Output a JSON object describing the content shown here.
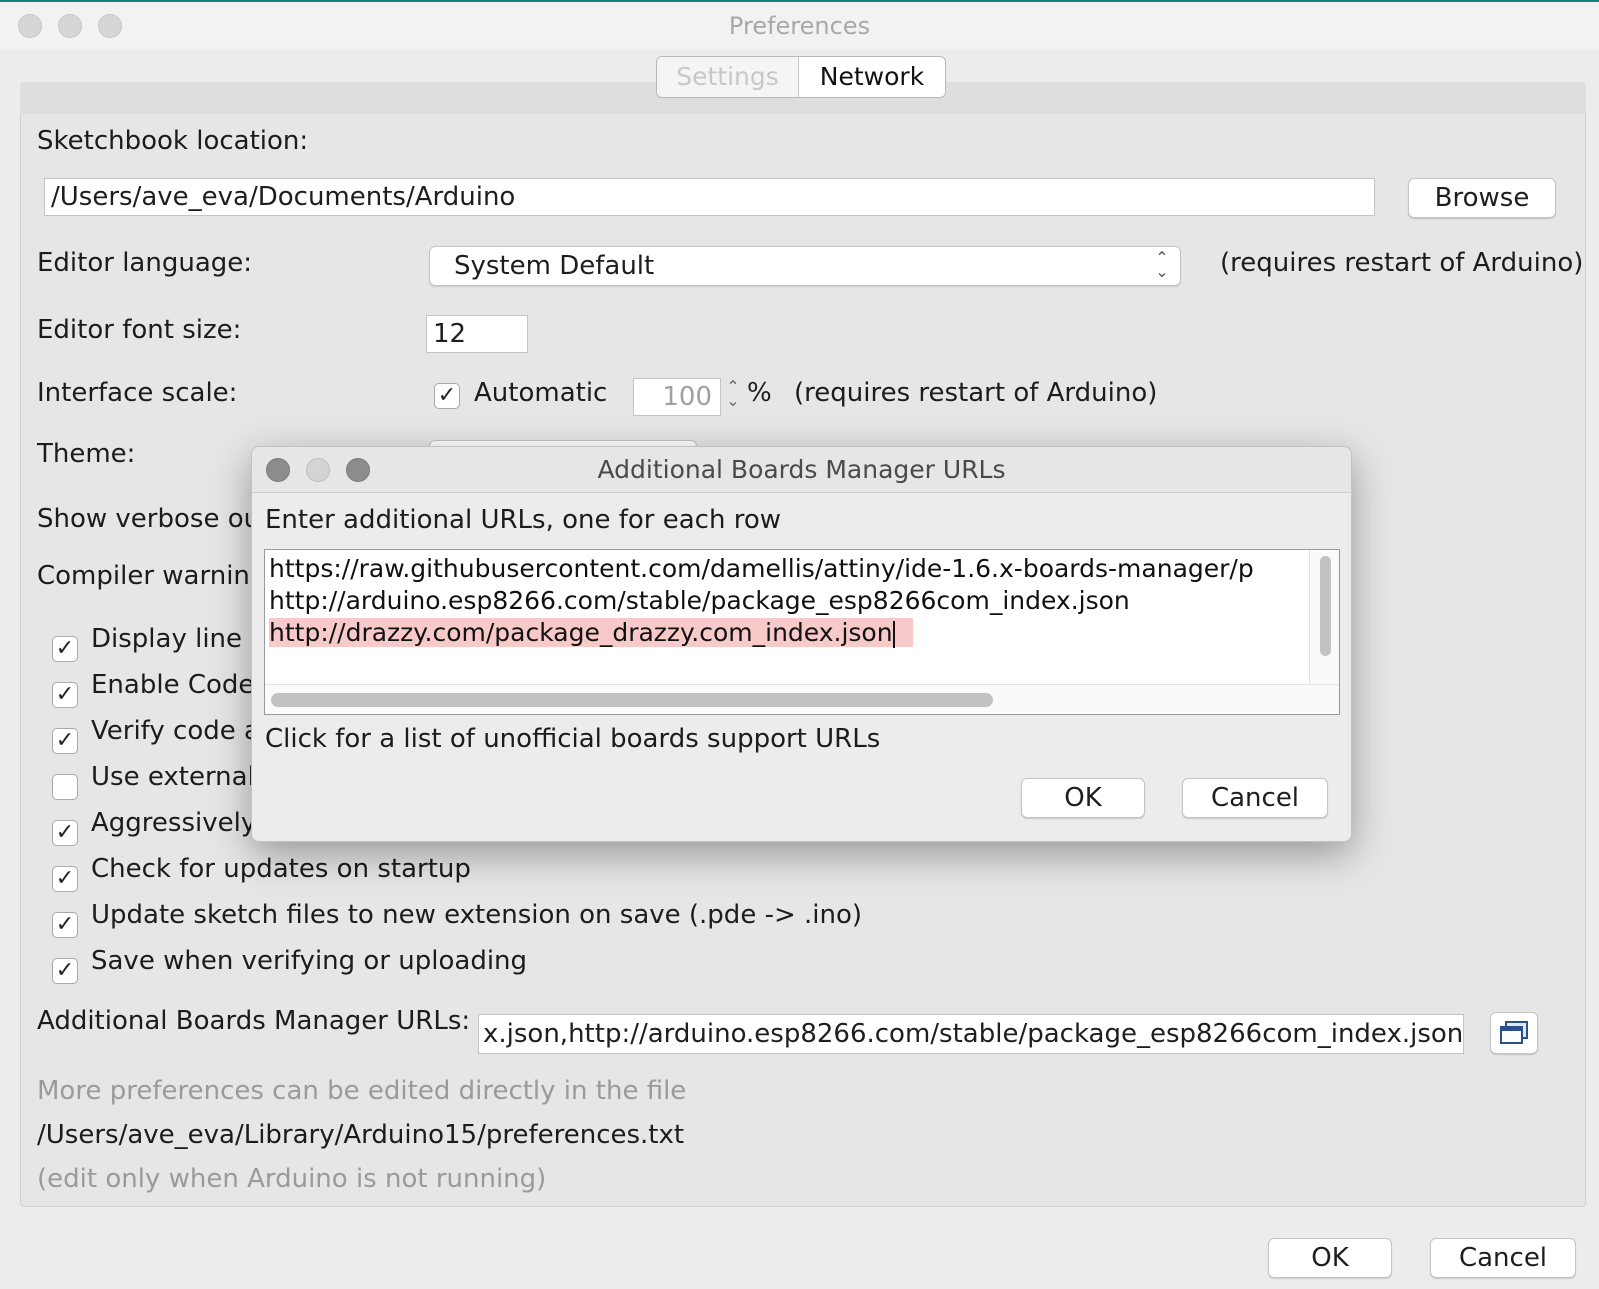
{
  "window": {
    "title": "Preferences"
  },
  "tabs": [
    {
      "label": "Settings"
    },
    {
      "label": "Network"
    }
  ],
  "sketchbook": {
    "label": "Sketchbook location:",
    "value": "/Users/ave_eva/Documents/Arduino",
    "browse_label": "Browse"
  },
  "editor_language": {
    "label": "Editor language:",
    "value": "System Default",
    "note": "(requires restart of Arduino)"
  },
  "font_size": {
    "label": "Editor font size:",
    "value": "12"
  },
  "interface_scale": {
    "label": "Interface scale:",
    "automatic_label": "Automatic",
    "automatic_checked": true,
    "value": "100",
    "unit": "%",
    "note": "(requires restart of Arduino)"
  },
  "theme": {
    "label": "Theme:"
  },
  "partial_labels": {
    "verbose": "Show verbose ou",
    "compiler": "Compiler warning"
  },
  "checkboxes": [
    {
      "label": "Display line r",
      "checked": true
    },
    {
      "label": "Enable Code",
      "checked": true
    },
    {
      "label": "Verify code a",
      "checked": true
    },
    {
      "label": "Use external",
      "checked": false
    },
    {
      "label": "Aggressively",
      "checked": true
    },
    {
      "label": "Check for updates on startup",
      "checked": true
    },
    {
      "label": "Update sketch files to new extension on save (.pde -> .ino)",
      "checked": true
    },
    {
      "label": "Save when verifying or uploading",
      "checked": true
    }
  ],
  "boards_urls": {
    "label": "Additional Boards Manager URLs:",
    "value": "x.json,http://arduino.esp8266.com/stable/package_esp8266com_index.json"
  },
  "footer": {
    "more_prefs": "More preferences can be edited directly in the file",
    "path": "/Users/ave_eva/Library/Arduino15/preferences.txt",
    "note": "(edit only when Arduino is not running)"
  },
  "buttons": {
    "ok": "OK",
    "cancel": "Cancel"
  },
  "dialog": {
    "title": "Additional Boards Manager URLs",
    "instruction": "Enter additional URLs, one for each row",
    "urls": [
      "https://raw.githubusercontent.com/damellis/attiny/ide-1.6.x-boards-manager/p",
      "http://arduino.esp8266.com/stable/package_esp8266com_index.json",
      "http://drazzy.com/package_drazzy.com_index.json"
    ],
    "link_text": "Click for a list of unofficial boards support URLs",
    "ok_label": "OK",
    "cancel_label": "Cancel"
  },
  "colors": {
    "selection_highlight": "#f7c9c9",
    "window_bg": "#ececec"
  }
}
